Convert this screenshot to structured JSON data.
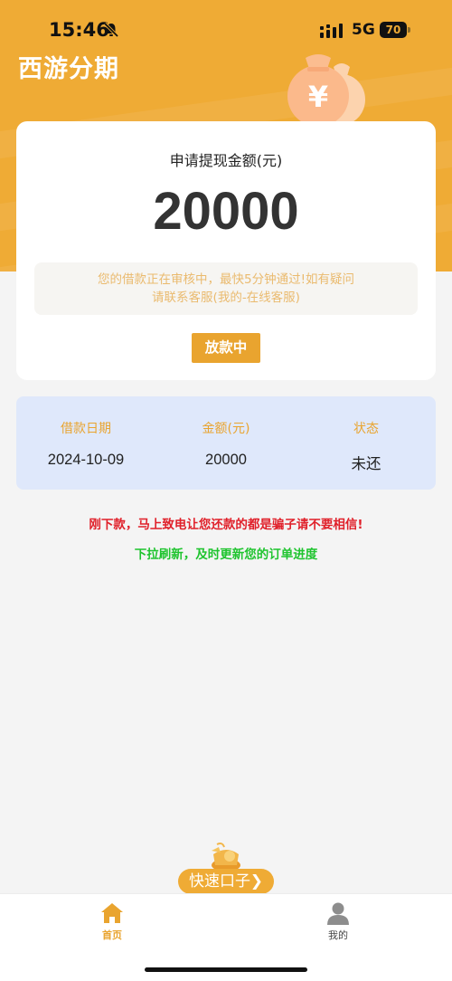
{
  "status_bar": {
    "time": "15:46",
    "network": "5G",
    "battery": "70"
  },
  "header": {
    "title": "西游分期"
  },
  "apply_card": {
    "label": "申请提现金额(元)",
    "amount": "20000",
    "notice_line1": "您的借款正在审核中，最快5分钟通过!如有疑问",
    "notice_line2": "请联系客服(我的-在线客服)",
    "status_button": "放款中"
  },
  "loan_record": {
    "columns": [
      {
        "header": "借款日期",
        "value": "2024-10-09"
      },
      {
        "header": "金额(元)",
        "value": "20000"
      },
      {
        "header": "状态",
        "value": "未还"
      }
    ]
  },
  "messages": {
    "warning": "刚下款，马上致电让您还款的都是骗子请不要相信!",
    "refresh_tip": "下拉刷新，及时更新您的订单进度"
  },
  "quick_entry": {
    "label": "快速口子"
  },
  "tabbar": {
    "items": [
      {
        "label": "首页",
        "icon": "home-icon",
        "active": true
      },
      {
        "label": "我的",
        "icon": "person-icon",
        "active": false
      }
    ]
  },
  "colors": {
    "brand": "#efab35",
    "button": "#e9a42f",
    "warning": "#e0202a",
    "tip": "#1fc42f",
    "table_bg": "#dfe8fb"
  }
}
